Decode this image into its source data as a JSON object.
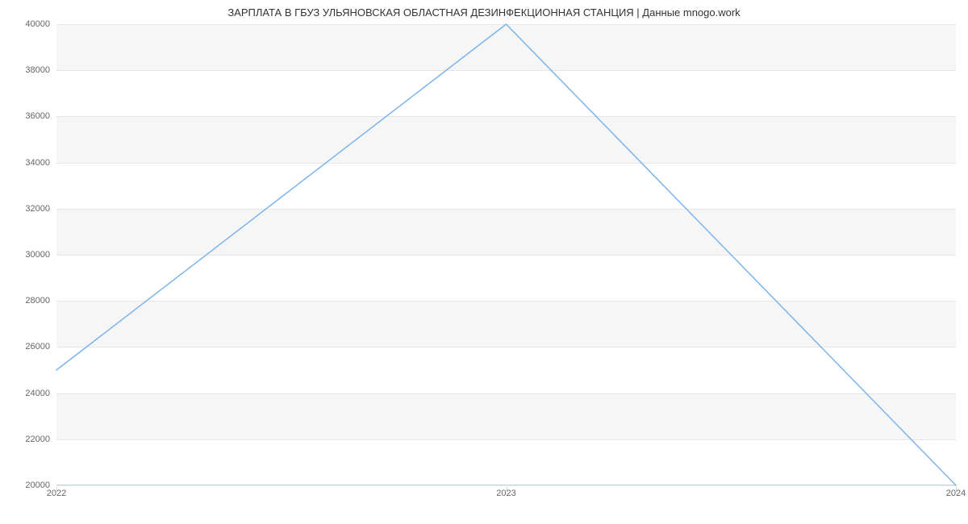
{
  "chart_data": {
    "type": "line",
    "title": "ЗАРПЛАТА В ГБУЗ УЛЬЯНОВСКАЯ ОБЛАСТНАЯ ДЕЗИНФЕКЦИОННАЯ СТАНЦИЯ | Данные mnogo.work",
    "x": [
      2022,
      2023,
      2024
    ],
    "values": [
      25000,
      40000,
      20000
    ],
    "xlabel": "",
    "ylabel": "",
    "xlim": [
      2022,
      2024
    ],
    "ylim": [
      20000,
      40000
    ],
    "x_ticks": [
      2022,
      2023,
      2024
    ],
    "y_ticks": [
      20000,
      22000,
      24000,
      26000,
      28000,
      30000,
      32000,
      34000,
      36000,
      38000,
      40000
    ],
    "line_color": "#7cb5ec",
    "alt_band_color": "#f6f6f6"
  }
}
